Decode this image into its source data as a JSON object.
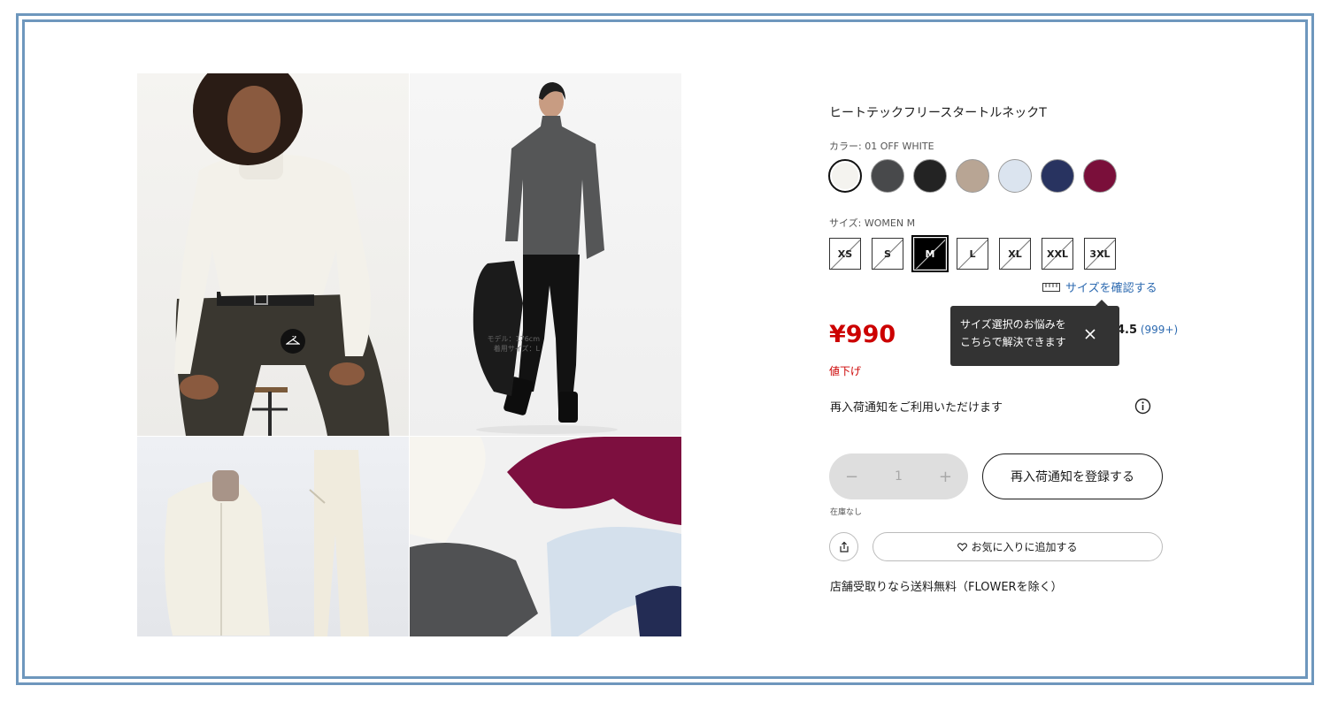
{
  "gallery": {
    "model_note_line1": "モデル：176cm",
    "model_note_line2": "着用サイズ：L"
  },
  "product": {
    "title": "ヒートテックフリースタートルネックT",
    "color_label": "カラー: 01 OFF WHITE",
    "colors": [
      {
        "name": "off-white",
        "hex": "#f4f3ef"
      },
      {
        "name": "dark-gray",
        "hex": "#48494b"
      },
      {
        "name": "black",
        "hex": "#232323"
      },
      {
        "name": "beige",
        "hex": "#b8a594"
      },
      {
        "name": "light-blue",
        "hex": "#dbe4ef"
      },
      {
        "name": "navy",
        "hex": "#283360"
      },
      {
        "name": "wine",
        "hex": "#7a0f3a"
      }
    ],
    "size_label": "サイズ: WOMEN M",
    "sizes": [
      "XS",
      "S",
      "M",
      "L",
      "XL",
      "XXL",
      "3XL"
    ],
    "selected_size": "M",
    "size_check_link": "サイズを確認する",
    "tooltip_line1": "サイズ選択のお悩みを",
    "tooltip_line2": "こちらで解決できます",
    "price": "¥990",
    "discount_label": "値下げ",
    "rating_score": "4.5",
    "rating_count": "(999+)",
    "restock_info": "再入荷通知をご利用いただけます",
    "quantity": "1",
    "qty_minus": "−",
    "qty_plus": "+",
    "restock_button": "再入荷通知を登録する",
    "stock_status": "在庫なし",
    "favorite_button": "お気に入りに追加する",
    "pickup_note": "店舗受取りなら送料無料（FLOWERを除く）"
  },
  "colors": {
    "frame": "#6e97bd",
    "price_red": "#cc0000",
    "link_blue": "#2d6ab0",
    "tooltip_bg": "#333333"
  }
}
